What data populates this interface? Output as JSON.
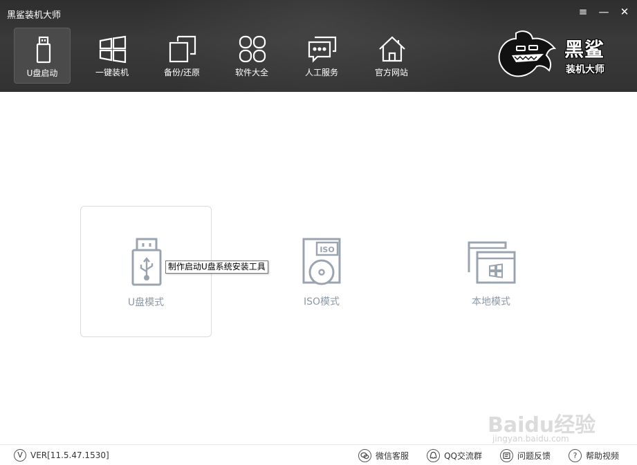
{
  "app": {
    "title": "黑鲨装机大师"
  },
  "window_controls": {
    "menu": "≡",
    "minimize": "—",
    "close": "✕"
  },
  "nav": {
    "items": [
      {
        "label": "U盘启动",
        "icon": "usb-drive-icon",
        "active": true
      },
      {
        "label": "一键装机",
        "icon": "windows-icon",
        "active": false
      },
      {
        "label": "备份/还原",
        "icon": "backup-icon",
        "active": false
      },
      {
        "label": "软件大全",
        "icon": "apps-grid-icon",
        "active": false
      },
      {
        "label": "人工服务",
        "icon": "chat-icon",
        "active": false
      },
      {
        "label": "官方网站",
        "icon": "home-icon",
        "active": false
      }
    ]
  },
  "brand": {
    "name": "黑鲨",
    "subtitle": "装机大师",
    "logo": "shark-logo"
  },
  "modes": {
    "usb": {
      "label": "U盘模式",
      "icon": "usb-drive-icon"
    },
    "iso": {
      "label": "ISO模式",
      "icon_text": "ISO"
    },
    "local": {
      "label": "本地模式",
      "icon": "windows-icon"
    }
  },
  "tooltip": {
    "text": "制作启动U盘系统安装工具"
  },
  "footer": {
    "version_badge": "V",
    "version": "VER[11.5.47.1530]",
    "links": {
      "wechat": "微信客服",
      "qq": "QQ交流群",
      "feedback": "问题反馈",
      "help": "帮助视频"
    }
  },
  "watermark": {
    "text": "Baidu经验",
    "sub": "jingyan.baidu.com"
  },
  "colors": {
    "header_bg": "#333333",
    "mode_gray": "#8c98a6",
    "icon_gray": "#9aa4b0"
  }
}
